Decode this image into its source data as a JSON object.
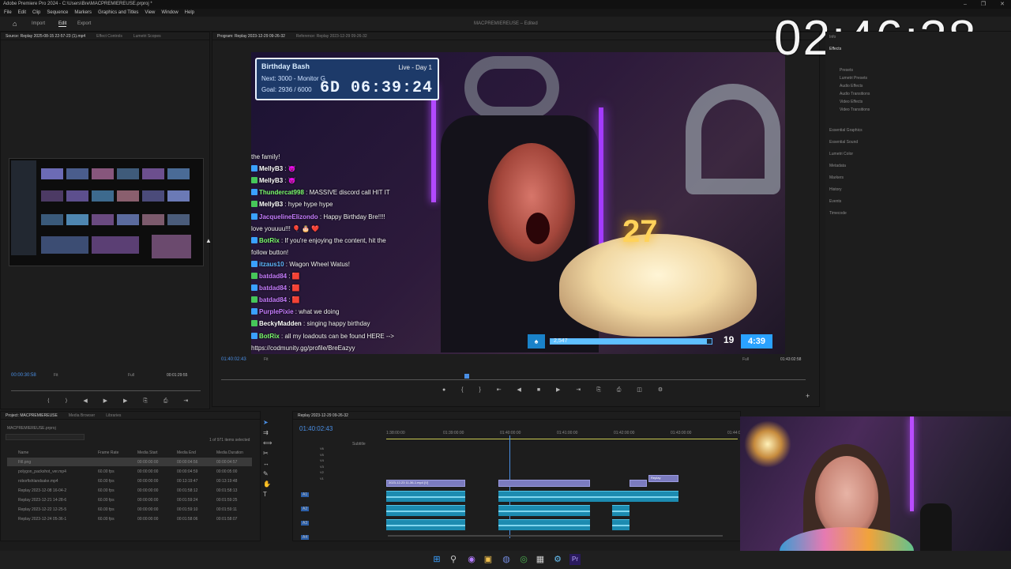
{
  "window": {
    "title": "Adobe Premiere Pro 2024 - C:\\Users\\Bre\\MACPREMIEREUSE.prproj *",
    "controls": [
      "–",
      "❐",
      "✕"
    ]
  },
  "menu": [
    "File",
    "Edit",
    "Clip",
    "Sequence",
    "Markers",
    "Graphics and Titles",
    "View",
    "Window",
    "Help"
  ],
  "workspace": {
    "tabs": [
      "Import",
      "Edit",
      "Export"
    ],
    "active_tab": "Edit",
    "doc_title": "MACPREMIEREUSE – Edited"
  },
  "clock": "02:46:38",
  "source_panel": {
    "tabs": [
      "Source: Replay 2025-08-15 22-57-23 (1).mp4",
      "Effect Controls",
      "Lumetri Scopes"
    ],
    "timecode_in": "00:00:30:58",
    "fit": "Fit",
    "quality": "Full",
    "timecode_dur": "00:01:29:55"
  },
  "program_panel": {
    "tabs": [
      "Program: Replay 2023-12-29 09-26-32",
      "Reference: Replay 2023-12-29 09-26-32"
    ],
    "timecode": "01:40:02:43",
    "fit": "Fit",
    "quality": "Full",
    "duration": "01:43:02:58"
  },
  "stream_overlay": {
    "title": "Birthday Bash",
    "live": "Live - Day 1",
    "next": "Next: 3000 - Monitor G",
    "goal": "Goal: 2936 / 6000",
    "timer": "6D 06:39:24"
  },
  "chat": [
    {
      "name": "",
      "text": "the family!",
      "color": "#ffffff"
    },
    {
      "name": "MellyB3",
      "text": " : 😈",
      "color": "#ffffff"
    },
    {
      "name": "MellyB3",
      "text": " : 😈",
      "color": "#ffffff"
    },
    {
      "name": "Thundercat998",
      "text": " : MASSIVE discord call HIT IT",
      "color": "#7CFC6E"
    },
    {
      "name": "MellyB3",
      "text": " : hype hype hype",
      "color": "#ffffff"
    },
    {
      "name": "JacquelineElizondo",
      "text": " : Happy Birthday Bre!!!!",
      "color": "#c77dff"
    },
    {
      "name": "",
      "text": "love youuuu!!! 🎈 🎂 ❤️",
      "color": "#ffffff"
    },
    {
      "name": "BotRix",
      "text": " : If you're enjoying the content, hit the",
      "color": "#7CFC6E"
    },
    {
      "name": "",
      "text": "follow button!",
      "color": "#ffffff"
    },
    {
      "name": "itzaus10",
      "text": " : Wagon Wheel Watus!",
      "color": "#5fb8ff"
    },
    {
      "name": "batdad84",
      "text": " : 🟥",
      "color": "#c77dff"
    },
    {
      "name": "batdad84",
      "text": " : 🟥",
      "color": "#c77dff"
    },
    {
      "name": "batdad84",
      "text": " : 🟥",
      "color": "#c77dff"
    },
    {
      "name": "PurplePixie",
      "text": " : what we doing",
      "color": "#c77dff"
    },
    {
      "name": "BeckyMadden",
      "text": " : singing happy birthday",
      "color": "#ffffff"
    },
    {
      "name": "BotRix",
      "text": " : all my loadouts can be found HERE -->",
      "color": "#7CFC6E"
    },
    {
      "name": "",
      "text": "https://codmunity.gg/profile/BreEazyy",
      "color": "#ffffff"
    }
  ],
  "goal_bar": {
    "label": "2,547",
    "progress": 0.97,
    "count": "19",
    "time": "4:39"
  },
  "effects_panel": {
    "tabs": [
      "Info",
      "Effects"
    ],
    "categories": [
      "Presets",
      "Lumetri Presets",
      "Audio Effects",
      "Audio Transitions",
      "Video Effects",
      "Video Transitions"
    ],
    "panels": [
      "Essential Graphics",
      "Essential Sound",
      "Lumetri Color",
      "Metadata",
      "Markers",
      "History",
      "Events",
      "Timecode"
    ]
  },
  "project_panel": {
    "tabs": [
      "Project: MACPREMIEREUSE",
      "Media Browser",
      "Libraries"
    ],
    "file": "MACPREMIEREUSE.prproj",
    "selected_info": "1 of 971 items selected",
    "columns": [
      "Name",
      "Frame Rate",
      "Media Start",
      "Media End",
      "Media Duration"
    ],
    "rows": [
      {
        "name": "Fill.png",
        "fps": "",
        "start": "00:00:00:00",
        "end": "00:00:04:56",
        "dur": "00:00:04:57"
      },
      {
        "name": "polygon_packshot_ver.mp4",
        "fps": "60.00 fps",
        "start": "00:00:00:00",
        "end": "00:00:04:59",
        "dur": "00:00:05:00"
      },
      {
        "name": "roborfishlandsake.mp4",
        "fps": "60.00 fps",
        "start": "00:00:00:00",
        "end": "00:13:19:47",
        "dur": "00:13:19:48"
      },
      {
        "name": "Replay 2023-12-08 16-04-2",
        "fps": "60.00 fps",
        "start": "00:00:00:00",
        "end": "00:01:58:12",
        "dur": "00:01:58:13"
      },
      {
        "name": "Replay 2023-12-21 14-28-6",
        "fps": "60.00 fps",
        "start": "00:00:00:00",
        "end": "00:01:59:24",
        "dur": "00:01:59:25"
      },
      {
        "name": "Replay 2023-12-22 12-25-5",
        "fps": "60.00 fps",
        "start": "00:00:00:00",
        "end": "00:01:59:10",
        "dur": "00:01:59:11"
      },
      {
        "name": "Replay 2023-12-24 05-36-1",
        "fps": "60.00 fps",
        "start": "00:00:00:00",
        "end": "00:01:58:06",
        "dur": "00:01:58:07"
      }
    ]
  },
  "timeline": {
    "tab": "Replay 2023-12-29 09-26-32",
    "timecode": "01:40:02:43",
    "ruler": [
      "1:38:00:00",
      "01:39:00:00",
      "01:40:00:00",
      "01:41:00:00",
      "01:42:00:00",
      "01:43:00:00",
      "01:44:00"
    ],
    "clip_label": "2023-12-23 11-36-1.mp4 [V]",
    "clip_label2": "Replay",
    "tracks_video": [
      "V6",
      "V5",
      "V4",
      "V3",
      "V2",
      "V1"
    ],
    "tracks_audio": [
      "A1",
      "A2",
      "A3",
      "A4"
    ],
    "subtitle": "Subtitle"
  },
  "taskbar": {
    "icons": [
      "windows-icon",
      "search-icon",
      "copilot-icon",
      "explorer-icon",
      "discord-icon",
      "chrome-icon",
      "mic-icon",
      "steam-icon",
      "premiere-icon"
    ]
  }
}
